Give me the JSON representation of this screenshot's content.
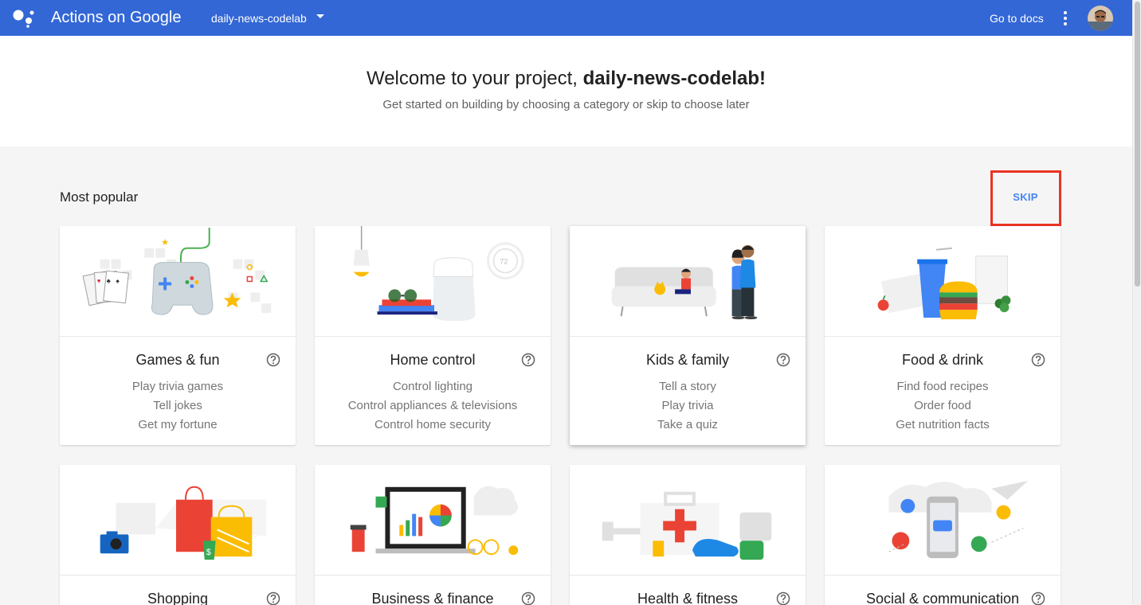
{
  "header": {
    "app_title": "Actions on Google",
    "project_name": "daily-news-codelab",
    "docs_link": "Go to docs"
  },
  "welcome": {
    "title_prefix": "Welcome to your project, ",
    "title_project": "daily-news-codelab!",
    "subtitle": "Get started on building by choosing a category or skip to choose later"
  },
  "section": {
    "title": "Most popular",
    "skip_label": "SKIP"
  },
  "categories": [
    {
      "title": "Games & fun",
      "items": [
        "Play trivia games",
        "Tell jokes",
        "Get my fortune"
      ]
    },
    {
      "title": "Home control",
      "items": [
        "Control lighting",
        "Control appliances & televisions",
        "Control home security"
      ]
    },
    {
      "title": "Kids & family",
      "items": [
        "Tell a story",
        "Play trivia",
        "Take a quiz"
      ]
    },
    {
      "title": "Food & drink",
      "items": [
        "Find food recipes",
        "Order food",
        "Get nutrition facts"
      ]
    },
    {
      "title": "Shopping",
      "items": []
    },
    {
      "title": "Business & finance",
      "items": []
    },
    {
      "title": "Health & fitness",
      "items": []
    },
    {
      "title": "Social & communication",
      "items": []
    }
  ],
  "colors": {
    "header_bg": "#3367d6",
    "accent": "#4285f4",
    "highlight_box": "#ea3323"
  }
}
